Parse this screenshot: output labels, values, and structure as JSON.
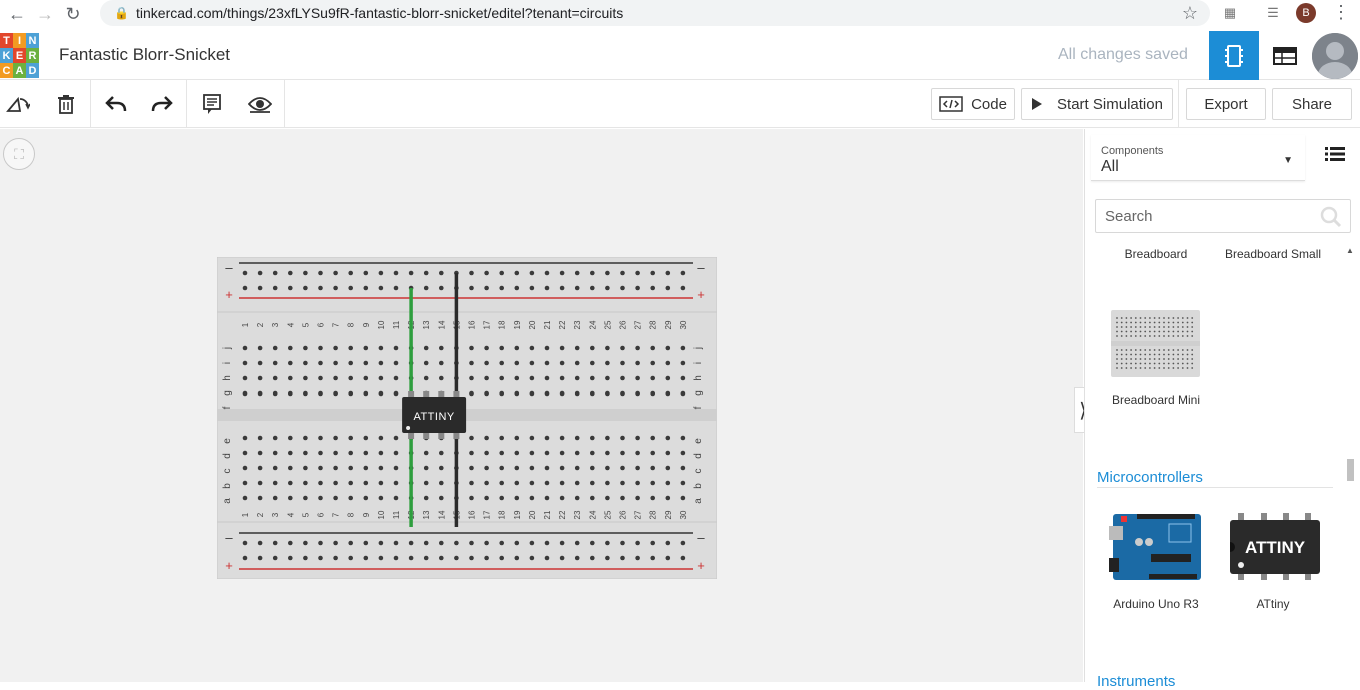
{
  "browser": {
    "url": "tinkercad.com/things/23xfLYSu9fR-fantastic-blorr-snicket/editel?tenant=circuits",
    "profile_initial": "B"
  },
  "app": {
    "logo_letters": [
      "T",
      "I",
      "N",
      "K",
      "E",
      "R",
      "C",
      "A",
      "D"
    ],
    "logo_colors": [
      "#e2462b",
      "#f29b22",
      "#4da1d6",
      "#4da1d6",
      "#e2462b",
      "#6cb13f",
      "#f29b22",
      "#6cb13f",
      "#4da1d6"
    ],
    "project_title": "Fantastic Blorr-Snicket",
    "save_status": "All changes saved",
    "accent": "#1c8dd6"
  },
  "toolbar": {
    "code_label": "Code",
    "start_simulation_label": "Start Simulation",
    "export_label": "Export",
    "share_label": "Share"
  },
  "canvas": {
    "chip_label": "ATTINY",
    "breadboard_row_letters_top": [
      "j",
      "i",
      "h",
      "g",
      "f"
    ],
    "breadboard_row_letters_bottom": [
      "e",
      "d",
      "c",
      "b",
      "a"
    ],
    "breadboard_columns": 30,
    "rail_minus": "–",
    "rail_plus": "+",
    "wire_colors": {
      "green": "#2e9e3e",
      "black": "#2b2b2b"
    }
  },
  "sidebar": {
    "components_label": "Components",
    "components_value": "All",
    "search_placeholder": "Search",
    "items_top": [
      "Breadboard",
      "Breadboard Small"
    ],
    "breadboard_mini_label": "Breadboard Mini",
    "section_microcontrollers": "Microcontrollers",
    "arduino_label": "Arduino Uno R3",
    "attiny_label": "ATtiny",
    "attiny_icon_text": "ATTINY",
    "section_instruments": "Instruments"
  }
}
